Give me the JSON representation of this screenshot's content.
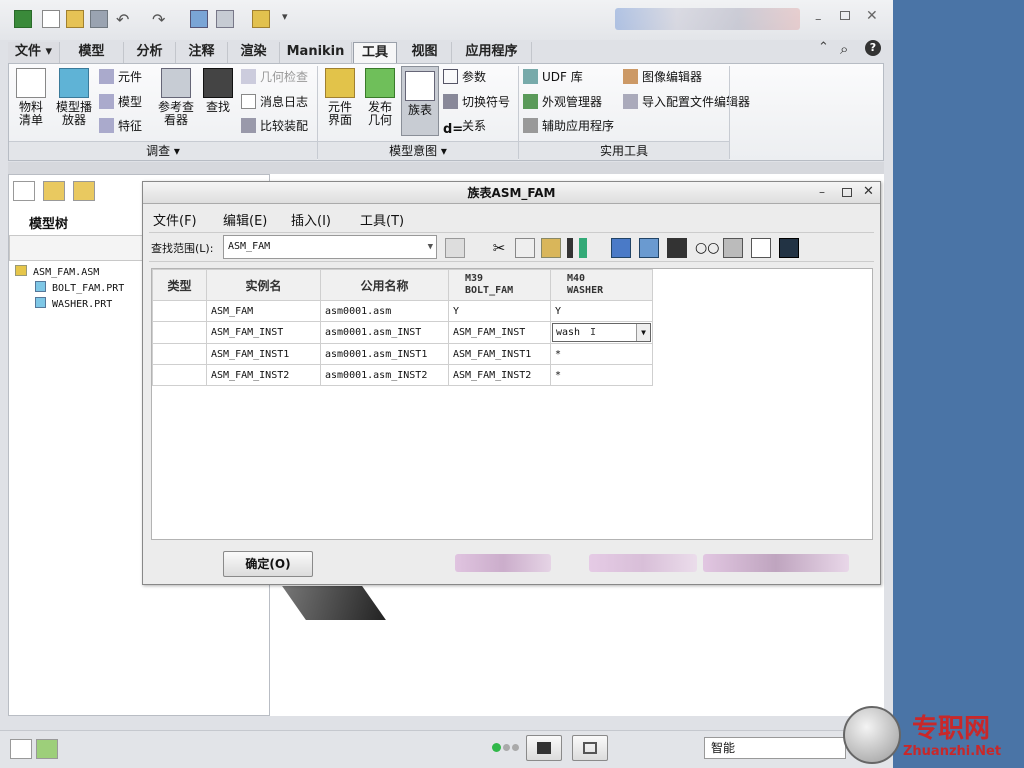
{
  "ribbon_tabs": [
    "文件",
    "模型",
    "分析",
    "注释",
    "渲染",
    "Manikin",
    "工具",
    "视图",
    "应用程序"
  ],
  "ribbon": {
    "investigate": {
      "bom": "物料\n清单",
      "model_player": "模型播\n放器",
      "component": "元件",
      "model": "模型",
      "feature": "特征",
      "ref_viewer": "参考查\n看器",
      "find": "查找",
      "geom_check": "几何检查",
      "message_log": "消息日志",
      "compare_asm": "比较装配",
      "group": "调查"
    },
    "model_intent": {
      "comp_interface": "元件\n界面",
      "publish_geom": "发布\n几何",
      "family_table": "族表",
      "params": "参数",
      "switch_symbols": "切换符号",
      "relations": "关系",
      "group": "模型意图"
    },
    "utilities": {
      "udf_lib": "UDF 库",
      "appearance_mgr": "外观管理器",
      "aux_apps": "辅助应用程序",
      "image_editor": "图像编辑器",
      "import_config_editor": "导入配置文件编辑器",
      "group": "实用工具"
    }
  },
  "left_panel": {
    "tree_label": "模型树",
    "root": "ASM_FAM.ASM",
    "children": [
      "BOLT_FAM.PRT",
      "WASHER.PRT"
    ]
  },
  "dialog": {
    "title": "族表ASM_FAM",
    "menus": [
      "文件(F)",
      "编辑(E)",
      "插入(I)",
      "工具(T)"
    ],
    "lookup_label": "查找范围(L):",
    "lookup_value": "ASM_FAM",
    "columns": [
      "类型",
      "实例名",
      "公用名称",
      "M39\nBOLT_FAM",
      "M40\nWASHER"
    ],
    "rows": [
      [
        "",
        "ASM_FAM",
        "asm0001.asm",
        "Y",
        "Y"
      ],
      [
        "",
        "ASM_FAM_INST",
        "asm0001.asm_INST",
        "ASM_FAM_INST",
        "wash"
      ],
      [
        "",
        "ASM_FAM_INST1",
        "asm0001.asm_INST1",
        "ASM_FAM_INST1",
        "*"
      ],
      [
        "",
        "ASM_FAM_INST2",
        "asm0001.asm_INST2",
        "ASM_FAM_INST2",
        "*"
      ]
    ],
    "ok_button": "确定(O)"
  },
  "status": {
    "filter_value": "智能"
  },
  "watermark": {
    "cn": "专职网",
    "en": "Zhuanzhi.Net"
  },
  "colors": {
    "desktop": "#4a74a6",
    "accent": "#2f6fd0"
  }
}
